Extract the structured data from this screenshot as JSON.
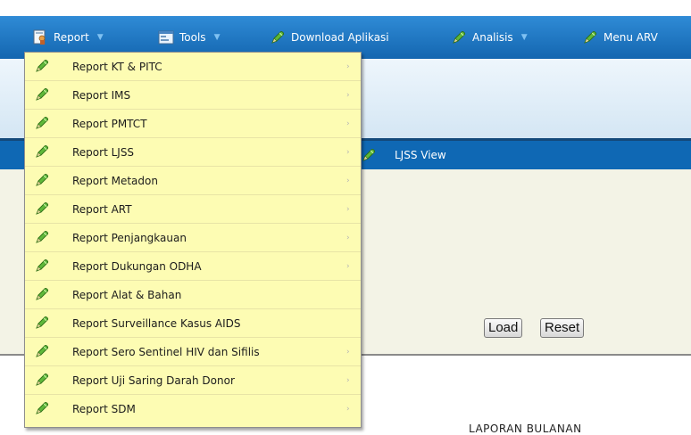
{
  "menubar": {
    "items": [
      {
        "label": "Report",
        "icon": "report-icon",
        "has_dropdown": true
      },
      {
        "label": "Tools",
        "icon": "tools-icon",
        "has_dropdown": true
      },
      {
        "label": "Download Aplikasi",
        "icon": "pencil-icon",
        "has_dropdown": false
      },
      {
        "label": "Analisis",
        "icon": "pencil-icon",
        "has_dropdown": true
      },
      {
        "label": "Menu ARV",
        "icon": "pencil-icon",
        "has_dropdown": false
      }
    ],
    "arrow_glyph": "▼"
  },
  "report_menu": {
    "items": [
      {
        "label": "Report KT & PITC",
        "has_submenu": true
      },
      {
        "label": "Report IMS",
        "has_submenu": true
      },
      {
        "label": "Report PMTCT",
        "has_submenu": true
      },
      {
        "label": "Report LJSS",
        "has_submenu": true
      },
      {
        "label": "Report Metadon",
        "has_submenu": true
      },
      {
        "label": "Report ART",
        "has_submenu": true
      },
      {
        "label": "Report Penjangkauan",
        "has_submenu": true
      },
      {
        "label": "Report Dukungan ODHA",
        "has_submenu": true
      },
      {
        "label": "Report Alat & Bahan",
        "has_submenu": false
      },
      {
        "label": "Report Surveillance Kasus AIDS",
        "has_submenu": false
      },
      {
        "label": "Report Sero Sentinel HIV dan Sifilis",
        "has_submenu": true
      },
      {
        "label": "Report Uji Saring Darah Donor",
        "has_submenu": true
      },
      {
        "label": "Report SDM",
        "has_submenu": true
      }
    ],
    "chevron_glyph": "›"
  },
  "subnav": {
    "label": "LJSS View",
    "icon": "pencil-icon"
  },
  "buttons": {
    "load": "Load",
    "reset": "Reset"
  },
  "main": {
    "heading": "LAPORAN BULANAN"
  },
  "colors": {
    "menubar": "#1f78c8",
    "subnav": "#0f68b4",
    "dropdown_bg": "#fdfcb3",
    "content_bg": "#f3f3e6",
    "pencil_green": "#4fae32"
  }
}
